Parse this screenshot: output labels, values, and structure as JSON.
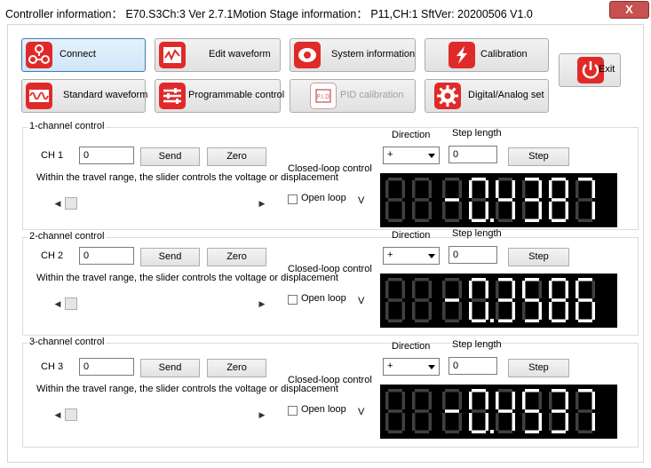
{
  "title": "Controller information： E70.S3Ch:3  Ver  2.7.1Motion Stage information： P11,CH:1  SftVer: 20200506 V1.0",
  "close_label": "X",
  "buttons": {
    "connect": "Connect",
    "edit_waveform": "Edit waveform",
    "system_information": "System information",
    "calibration": "Calibration",
    "exit": "Exit",
    "standard_waveform": "Standard waveform",
    "programmable_control": "Programmable control",
    "pid_calibration": "PID calibration",
    "digital_analog_set": "Digital/Analog set"
  },
  "icons": {
    "connect": "connect-icon",
    "edit_waveform": "waveform-edit-icon",
    "system_information": "info-icon",
    "calibration": "calibration-icon",
    "exit": "power-icon",
    "standard_waveform": "sine-wave-icon",
    "programmable_control": "sliders-icon",
    "pid_calibration": "pid-icon",
    "digital_analog_set": "gear-icon"
  },
  "accent_color": "#e02a2a",
  "display_segment_color": "#ffffff",
  "display_inactive_color": "#404040",
  "channels": [
    {
      "group_title": "1-channel control",
      "ch_label": "CH 1",
      "value": "0",
      "send": "Send",
      "zero": "Zero",
      "hint": "Within the travel range, the slider controls the voltage or displacement",
      "closed_loop": "Closed-loop control",
      "open_loop": "Open loop",
      "unit": "V",
      "direction_label": "Direction",
      "direction_value": "+",
      "step_length_label": "Step length",
      "step_length_value": "0",
      "step": "Step",
      "display_value": "-0.4387",
      "display_text": "88-0.4387"
    },
    {
      "group_title": "2-channel control",
      "ch_label": "CH 2",
      "value": "0",
      "send": "Send",
      "zero": "Zero",
      "hint": "Within the travel range, the slider controls the voltage or displacement",
      "closed_loop": "Closed-loop control",
      "open_loop": "Open loop",
      "unit": "V",
      "direction_label": "Direction",
      "direction_value": "+",
      "step_length_label": "Step length",
      "step_length_value": "0",
      "step": "Step",
      "display_value": "-0.3586",
      "display_text": "88-0.3586"
    },
    {
      "group_title": "3-channel control",
      "ch_label": "CH 3",
      "value": "0",
      "send": "Send",
      "zero": "Zero",
      "hint": "Within the travel range, the slider controls the voltage or displacement",
      "closed_loop": "Closed-loop control",
      "open_loop": "Open loop",
      "unit": "V",
      "direction_label": "Direction",
      "direction_value": "+",
      "step_length_label": "Step length",
      "step_length_value": "0",
      "step": "Step",
      "display_value": "-0.4537",
      "display_text": "88-0.4537"
    }
  ]
}
